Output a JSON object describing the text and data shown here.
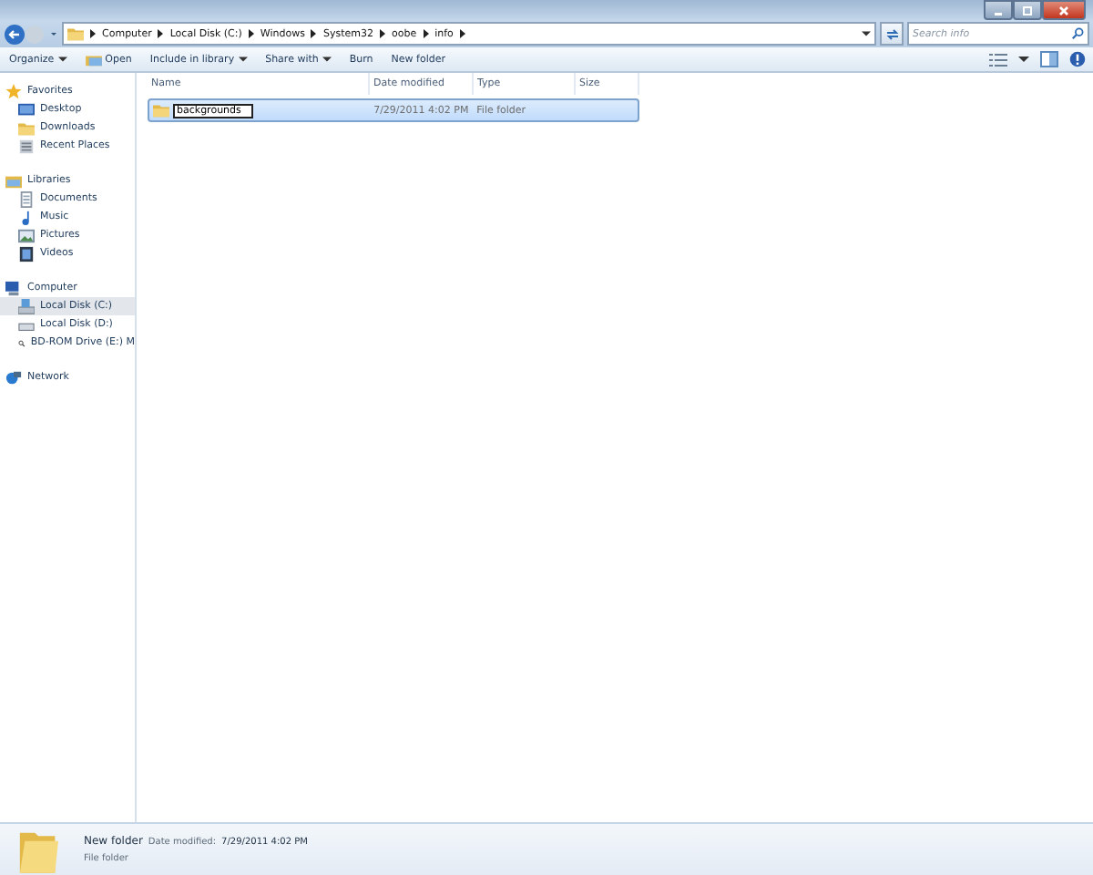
{
  "address": {
    "crumbs": [
      "Computer",
      "Local Disk (C:)",
      "Windows",
      "System32",
      "oobe",
      "info"
    ]
  },
  "search": {
    "placeholder": "Search info"
  },
  "toolbar": {
    "items": [
      {
        "label": "Organize",
        "dropdown": true
      },
      {
        "label": "Open",
        "dropdown": false
      },
      {
        "label": "Include in library",
        "dropdown": true
      },
      {
        "label": "Share with",
        "dropdown": true
      },
      {
        "label": "Burn",
        "dropdown": false
      },
      {
        "label": "New folder",
        "dropdown": false
      }
    ]
  },
  "sidebar": {
    "groups": [
      {
        "label": "Favorites",
        "children": [
          {
            "label": "Desktop",
            "selected": false
          },
          {
            "label": "Downloads",
            "selected": false
          },
          {
            "label": "Recent Places",
            "selected": false
          }
        ]
      },
      {
        "label": "Libraries",
        "children": [
          {
            "label": "Documents",
            "selected": false
          },
          {
            "label": "Music",
            "selected": false
          },
          {
            "label": "Pictures",
            "selected": false
          },
          {
            "label": "Videos",
            "selected": false
          }
        ]
      },
      {
        "label": "Computer",
        "children": [
          {
            "label": "Local Disk (C:)",
            "selected": true
          },
          {
            "label": "Local Disk (D:)",
            "selected": false
          },
          {
            "label": "BD-ROM Drive (E:) M",
            "selected": false
          }
        ]
      },
      {
        "label": "Network"
      }
    ]
  },
  "table": {
    "columns": [
      "Name",
      "Date modified",
      "Type",
      "Size"
    ],
    "rows": [
      {
        "name": "backgrounds",
        "date": "7/29/2011 4:02 PM",
        "type": "File folder",
        "selected": true,
        "renaming": true
      }
    ]
  },
  "details": {
    "name": "New folder",
    "date_label": "Date modified:",
    "date": "7/29/2011 4:02 PM",
    "type": "File folder"
  }
}
